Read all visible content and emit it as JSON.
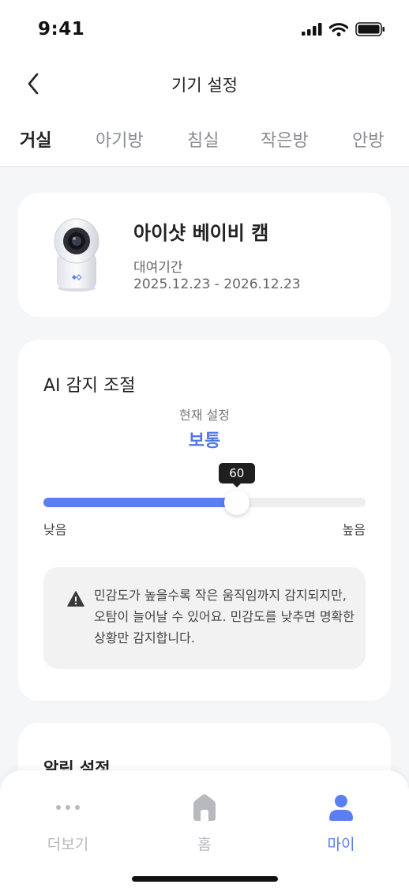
{
  "status_bar": {
    "time": "9:41"
  },
  "nav": {
    "title": "기기 설정",
    "back_icon": "chevron-left-icon"
  },
  "tabs": [
    {
      "label": "거실",
      "active": true
    },
    {
      "label": "아기방",
      "active": false
    },
    {
      "label": "침실",
      "active": false
    },
    {
      "label": "작은방",
      "active": false
    },
    {
      "label": "안방",
      "active": false
    }
  ],
  "device": {
    "name": "아이샷 베이비 캠",
    "rental_label": "대여기간",
    "rental_period": "2025.12.23 - 2026.12.23"
  },
  "ai_detection": {
    "title": "AI 감지 조절",
    "current_label": "현재 설정",
    "current_value": "보통",
    "slider_value": "60",
    "slider_level_percent": 60,
    "low_label": "낮음",
    "high_label": "높음",
    "warning_text": "민감도가 높을수록 작은 움직임까지 감지되지만, 오탐이 늘어날 수 있어요. 민감도를 낮추면 명확한 상황만 감지합니다."
  },
  "alarm": {
    "title": "알림 설정"
  },
  "bottom_nav": {
    "items": [
      {
        "label": "더보기",
        "icon": "more-dots-icon",
        "active": false
      },
      {
        "label": "홈",
        "icon": "home-icon",
        "active": false
      },
      {
        "label": "마이",
        "icon": "person-icon",
        "active": true
      }
    ]
  },
  "colors": {
    "accent": "#5b7ef0",
    "accent_text": "#4f77e8",
    "background": "#f5f6f8",
    "inactive": "#b7b9be"
  }
}
